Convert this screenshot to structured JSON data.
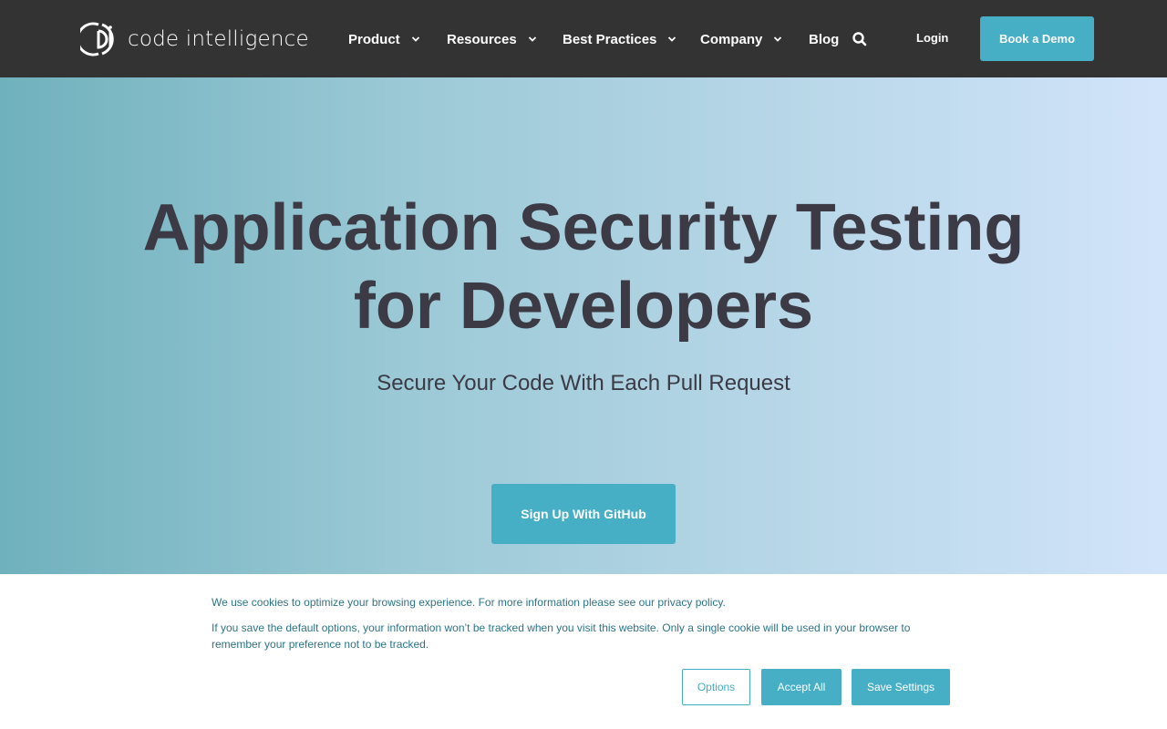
{
  "header": {
    "logo_text": "code intelligence",
    "nav": [
      {
        "label": "Product"
      },
      {
        "label": "Resources"
      },
      {
        "label": "Best Practices"
      },
      {
        "label": "Company"
      },
      {
        "label": "Blog"
      }
    ],
    "search_icon": "search-icon",
    "login_label": "Login",
    "demo_label": "Book a Demo"
  },
  "hero": {
    "title_line1": "Application Security Testing",
    "title_line2": "for Developers",
    "subtitle": "Secure Your Code With Each Pull Request",
    "cta_label": "Sign Up With GitHub"
  },
  "cookie": {
    "text_intro": "We use cookies to optimize your browsing experience. For more information please see our ",
    "privacy_link": "privacy policy",
    "text_period": ".",
    "text_2": "If you save the default options, your information won’t be tracked when you visit this website. Only a single cookie will be used in your browser to remember your preference not to be tracked.",
    "options_label": "Options",
    "accept_label": "Accept All",
    "save_label": "Save Settings"
  },
  "colors": {
    "header_bg": "#333333",
    "accent": "#46aec5",
    "title_text": "#3b3a45",
    "cookie_text": "#2e7485"
  }
}
